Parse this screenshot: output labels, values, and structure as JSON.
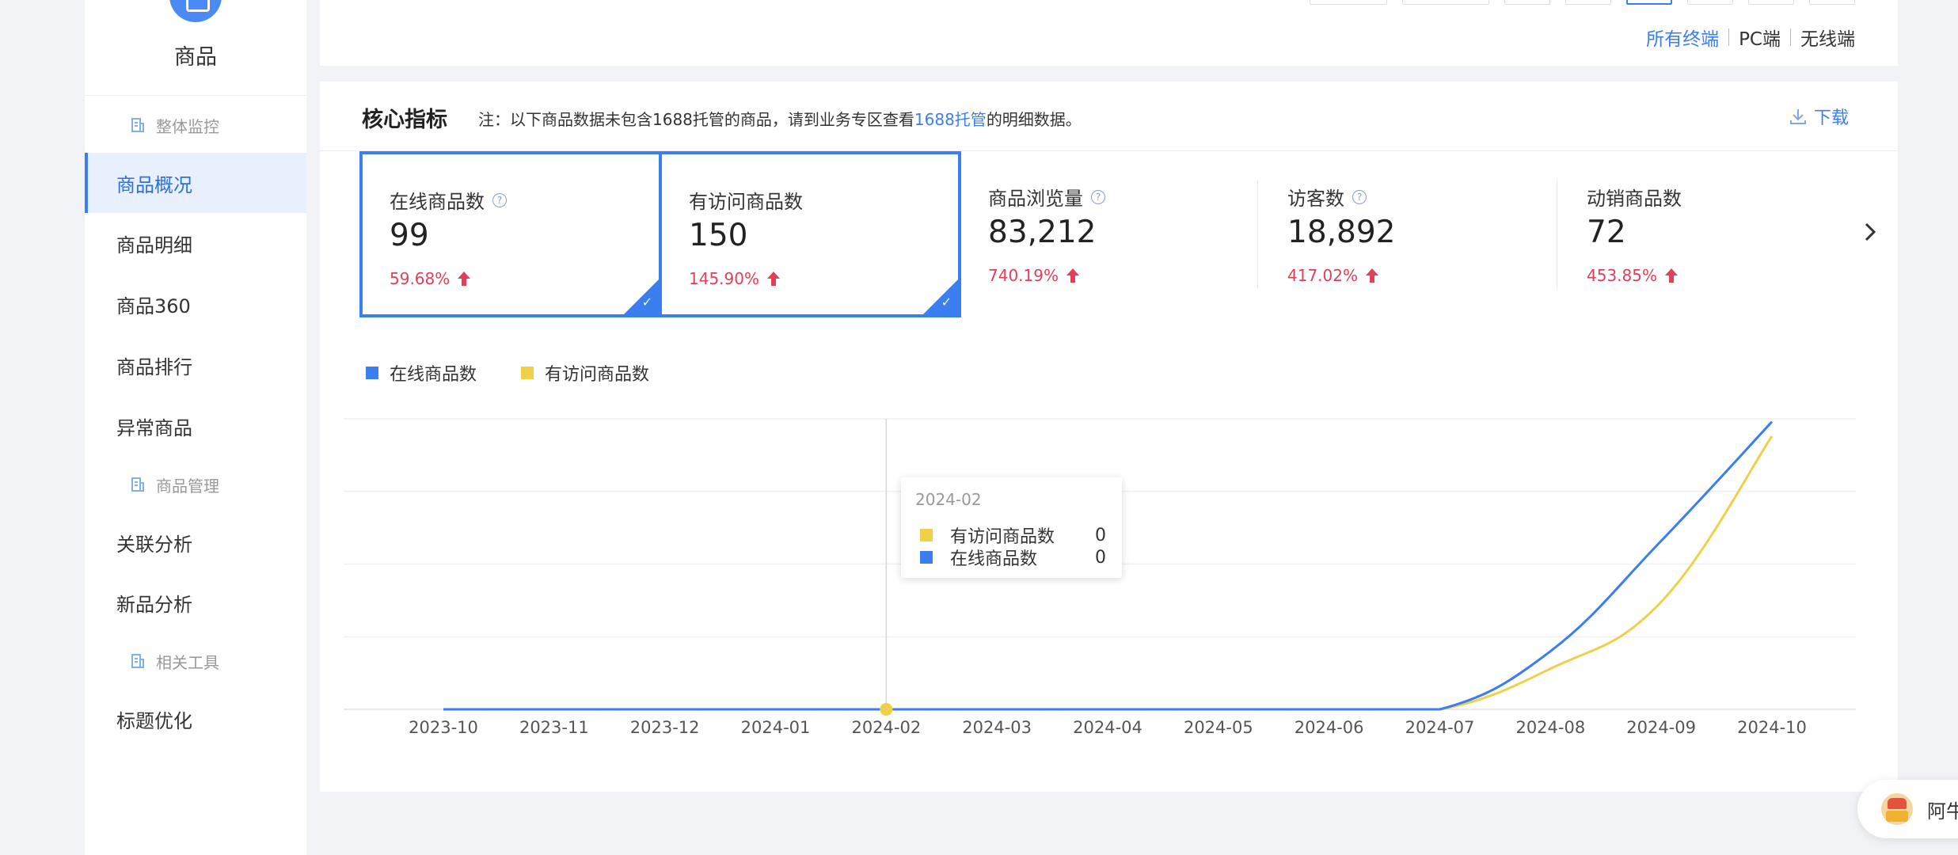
{
  "sidebar": {
    "title": "商品",
    "groups": [
      {
        "label": "整体监控"
      },
      {
        "label": "商品管理"
      },
      {
        "label": "相关工具"
      }
    ],
    "items": [
      {
        "label": "商品概况",
        "active": true
      },
      {
        "label": "商品明细"
      },
      {
        "label": "商品360"
      },
      {
        "label": "商品排行"
      },
      {
        "label": "异常商品"
      },
      {
        "label": "关联分析"
      },
      {
        "label": "新品分析"
      },
      {
        "label": "标题优化"
      }
    ]
  },
  "terminal": {
    "options": [
      "所有终端",
      "PC端",
      "无线端"
    ],
    "selected": "所有终端"
  },
  "card": {
    "title": "核心指标",
    "note_prefix": "注：以下商品数据未包含1688托管的商品，请到业务专区查看",
    "note_link": "1688托管",
    "note_suffix": "的明细数据。",
    "download_label": "下载"
  },
  "metrics": [
    {
      "title": "在线商品数",
      "value": "99",
      "change": "59.68%",
      "selected": true,
      "help": true
    },
    {
      "title": "有访问商品数",
      "value": "150",
      "change": "145.90%",
      "selected": true,
      "help": false
    },
    {
      "title": "商品浏览量",
      "value": "83,212",
      "change": "740.19%",
      "selected": false,
      "help": true
    },
    {
      "title": "访客数",
      "value": "18,892",
      "change": "417.02%",
      "selected": false,
      "help": true
    },
    {
      "title": "动销商品数",
      "value": "72",
      "change": "453.85%",
      "selected": false,
      "help": false
    }
  ],
  "colors": {
    "primary": "#3b7ef0",
    "series_online": "#3b7ef0",
    "series_visited": "#efd04a",
    "up": "#e0405a"
  },
  "chart_data": {
    "type": "line",
    "x": [
      "2023-10",
      "2023-11",
      "2023-12",
      "2024-01",
      "2024-02",
      "2024-03",
      "2024-04",
      "2024-05",
      "2024-06",
      "2024-07",
      "2024-08",
      "2024-09",
      "2024-10"
    ],
    "series": [
      {
        "name": "在线商品数",
        "color": "#3b7ef0",
        "values": [
          0,
          0,
          0,
          0,
          0,
          0,
          0,
          0,
          0,
          0,
          20,
          58,
          99
        ]
      },
      {
        "name": "有访问商品数",
        "color": "#efd04a",
        "values": [
          0,
          0,
          0,
          0,
          0,
          0,
          0,
          0,
          0,
          0,
          14,
          37,
          94
        ]
      }
    ],
    "ylim": [
      0,
      100
    ],
    "grid": true,
    "legend": "top-left",
    "hover": {
      "x": "2024-02"
    }
  },
  "tooltip": {
    "title": "2024-02",
    "rows": [
      {
        "name": "有访问商品数",
        "value": "0",
        "color": "#efd04a"
      },
      {
        "name": "在线商品数",
        "value": "0",
        "color": "#3b7ef0"
      }
    ]
  },
  "assistant": {
    "name": "阿牛"
  }
}
